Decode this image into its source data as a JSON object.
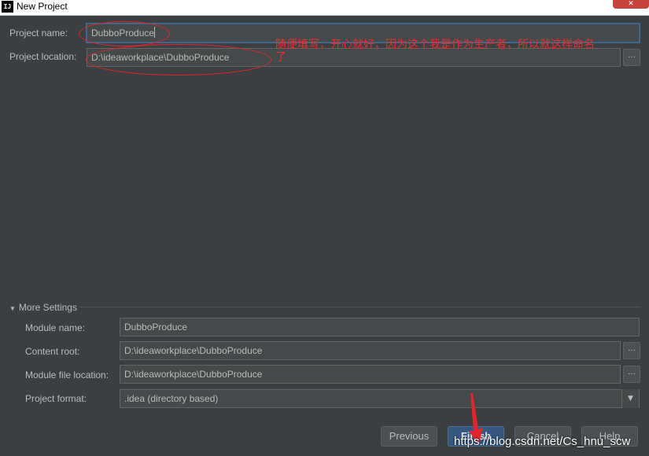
{
  "window": {
    "title": "New Project",
    "app_icon": "IJ",
    "close_glyph": "✕"
  },
  "project_name": {
    "label": "Project name:",
    "value": "DubboProduce"
  },
  "project_location": {
    "label": "Project location:",
    "value": "D:\\ideaworkplace\\DubboProduce",
    "browse_label": "..."
  },
  "annotation": {
    "line1": "随便填写，开心就好，因为这个我是作为生产者，所以就这样命名",
    "line2": "了",
    "color": "#ea2f31"
  },
  "more_settings": {
    "label": "More Settings",
    "module_name": {
      "label": "Module name:",
      "value": "DubboProduce"
    },
    "content_root": {
      "label": "Content root:",
      "value": "D:\\ideaworkplace\\DubboProduce",
      "browse_label": "..."
    },
    "module_file_location": {
      "label": "Module file location:",
      "value": "D:\\ideaworkplace\\DubboProduce",
      "browse_label": "..."
    },
    "project_format": {
      "label": "Project format:",
      "value": ".idea (directory based)",
      "arrow": "▼"
    }
  },
  "buttons": {
    "previous": "Previous",
    "finish": "Finish",
    "cancel": "Cancel",
    "help": "Help"
  },
  "watermark": "https://blog.csdn.net/Cs_hnu_scw",
  "colors": {
    "background": "#3c3f41",
    "field": "#45494a",
    "primary_button": "#365880",
    "annotation_red": "#e0252d"
  }
}
